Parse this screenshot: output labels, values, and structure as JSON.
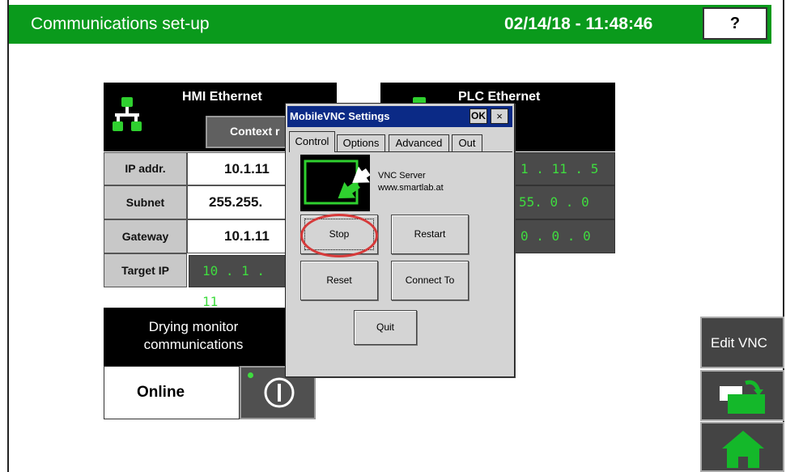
{
  "header": {
    "title": "Communications set-up",
    "datetime": "02/14/18 - 11:48:46",
    "help_label": "?"
  },
  "hmi": {
    "title": "HMI Ethernet",
    "context_label": "Context r",
    "rows": [
      {
        "label": "IP addr.",
        "value": "10.1.11"
      },
      {
        "label": "Subnet",
        "value": "255.255."
      },
      {
        "label": "Gateway",
        "value": "10.1.11"
      }
    ],
    "target_label": "Target IP",
    "target_value": "10 . 1 . 11"
  },
  "plc": {
    "title": "PLC Ethernet",
    "values": [
      "1 . 11 . 5",
      "55. 0 . 0",
      "0 . 0 . 0"
    ]
  },
  "drying": {
    "title_line1": "Drying monitor",
    "title_line2": "communications",
    "status": "Online"
  },
  "dialog": {
    "title": "MobileVNC Settings",
    "ok_label": "OK",
    "close_label": "×",
    "tabs": [
      {
        "label": "Control",
        "active": true
      },
      {
        "label": "Options",
        "active": false
      },
      {
        "label": "Advanced",
        "active": false
      },
      {
        "label": "Out",
        "active": false
      }
    ],
    "server_name": "VNC Server",
    "server_url": "www.smartlab.at",
    "buttons": {
      "stop": "Stop",
      "restart": "Restart",
      "reset": "Reset",
      "connect": "Connect To",
      "quit": "Quit"
    }
  },
  "side": {
    "edit_vnc": "Edit VNC"
  },
  "colors": {
    "title_bar": "#0a9a1c",
    "dialog_title": "#0b2a86",
    "ip_green": "#3fdc3f",
    "highlight": "#d63a3a"
  },
  "icons": [
    "network-icon",
    "power-icon",
    "vnc-arrow-icon",
    "page-flip-icon",
    "home-icon"
  ]
}
